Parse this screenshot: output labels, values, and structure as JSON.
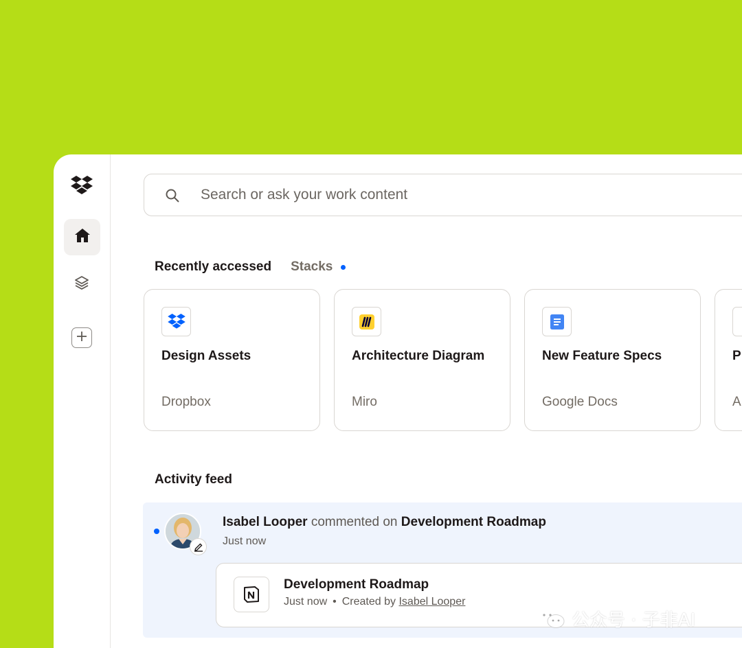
{
  "colors": {
    "background": "#b5dd17",
    "accent_blue": "#0061fe",
    "activity_bg": "#eff4fd",
    "miro_yellow": "#ffd02f",
    "google_docs_blue": "#4285f4"
  },
  "sidebar": {
    "logo_icon": "dropbox-logo-icon",
    "items": [
      {
        "name": "home",
        "icon": "home-icon",
        "active": true
      },
      {
        "name": "stacks",
        "icon": "stacks-layers-icon",
        "active": false
      },
      {
        "name": "add",
        "icon": "plus-icon",
        "active": false
      }
    ]
  },
  "search": {
    "placeholder": "Search or ask your work content",
    "icon": "search-icon"
  },
  "tabs": [
    {
      "label": "Recently accessed",
      "active": true
    },
    {
      "label": "Stacks",
      "active": false,
      "has_dot": true
    }
  ],
  "cards": [
    {
      "title": "Design Assets",
      "source": "Dropbox",
      "icon": "dropbox-icon"
    },
    {
      "title": "Architecture Diagram",
      "source": "Miro",
      "icon": "miro-icon"
    },
    {
      "title": "New Feature Specs",
      "source": "Google Docs",
      "icon": "google-docs-icon"
    },
    {
      "title": "P",
      "source": "A",
      "icon": "partial-app-icon"
    }
  ],
  "activity": {
    "section_title": "Activity feed",
    "items": [
      {
        "user": "Isabel Looper",
        "action": "commented on",
        "target": "Development Roadmap",
        "time": "Just now",
        "doc": {
          "title": "Development Roadmap",
          "time": "Just now",
          "separator": "•",
          "created_by_label": "Created by",
          "creator": "Isabel Looper",
          "icon": "notion-icon"
        }
      }
    ]
  },
  "watermark": {
    "text": "公众号 · 子非AI",
    "icon": "wechat-icon"
  }
}
